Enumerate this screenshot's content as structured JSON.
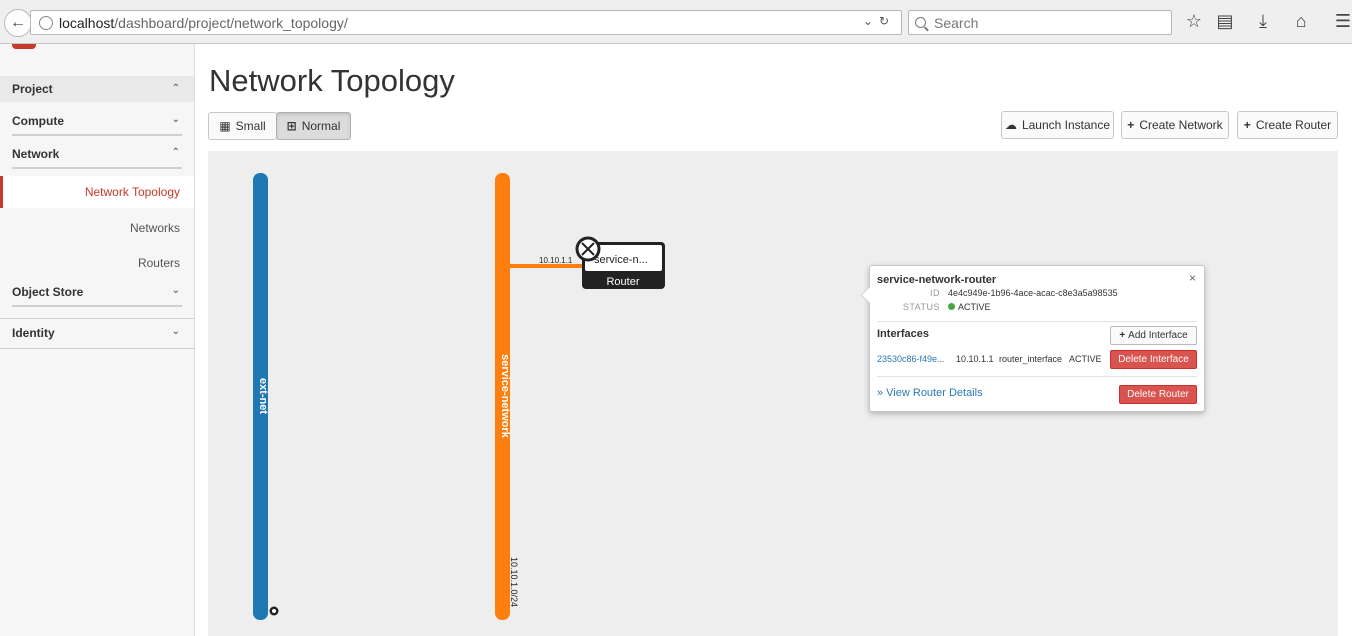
{
  "browser": {
    "url_host": "localhost",
    "url_path": "/dashboard/project/network_topology/",
    "search_placeholder": "Search"
  },
  "sidebar": {
    "project": "Project",
    "compute": "Compute",
    "network": "Network",
    "items": [
      {
        "label": "Network Topology",
        "active": true
      },
      {
        "label": "Networks",
        "active": false
      },
      {
        "label": "Routers",
        "active": false
      }
    ],
    "object_store": "Object Store",
    "identity": "Identity"
  },
  "main": {
    "title": "Network Topology",
    "view_small": "Small",
    "view_normal": "Normal",
    "launch_instance": "Launch Instance",
    "create_network": "Create Network",
    "create_router": "Create Router"
  },
  "topology": {
    "networks": [
      {
        "name": "ext-net",
        "color": "#1f77b4"
      },
      {
        "name": "service-network",
        "color": "#ff7f0e",
        "cidr": "10.10.1.0/24"
      }
    ],
    "router": {
      "name": "service-n...",
      "type": "Router",
      "link_ip": "10.10.1.1"
    }
  },
  "popup": {
    "title": "service-network-router",
    "id_label": "ID",
    "id_value": "4e4c949e-1b96-4ace-acac-c8e3a5a98535",
    "status_label": "STATUS",
    "status_value": "ACTIVE",
    "status_color": "#47a447",
    "interfaces_title": "Interfaces",
    "add_interface": "Add Interface",
    "interface": {
      "id": "23530c86-f49e...",
      "ip": "10.10.1.1",
      "type": "router_interface",
      "status": "ACTIVE"
    },
    "delete_interface": "Delete Interface",
    "view_details": "» View Router Details",
    "delete_router": "Delete Router",
    "close": "×"
  }
}
